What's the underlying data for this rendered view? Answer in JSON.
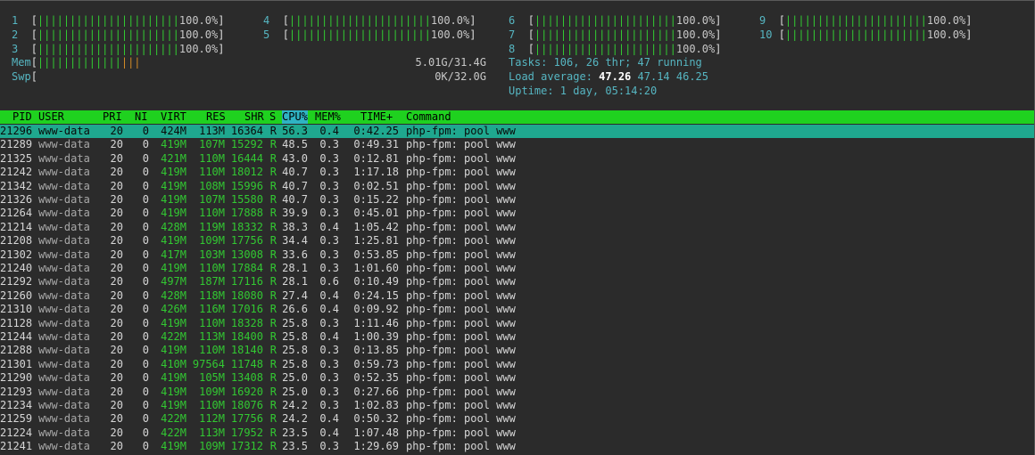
{
  "cpus": [
    {
      "id": "1",
      "pct": "100.0%"
    },
    {
      "id": "2",
      "pct": "100.0%"
    },
    {
      "id": "3",
      "pct": "100.0%"
    },
    {
      "id": "4",
      "pct": "100.0%"
    },
    {
      "id": "5",
      "pct": "100.0%"
    },
    {
      "id": "6",
      "pct": "100.0%"
    },
    {
      "id": "7",
      "pct": "100.0%"
    },
    {
      "id": "8",
      "pct": "100.0%"
    },
    {
      "id": "9",
      "pct": "100.0%"
    },
    {
      "id": "10",
      "pct": "100.0%"
    }
  ],
  "cpu_bar": "||||||||||||||||||||||",
  "mem": {
    "label": "Mem",
    "used_bar": "|||||||||||||",
    "buf_bar": "|||",
    "value": "5.01G/31.4G"
  },
  "swp": {
    "label": "Swp",
    "value": "0K/32.0G"
  },
  "tasks": {
    "label": "Tasks: ",
    "count": "106",
    "sep": ", ",
    "thr": "26",
    "thr_label": " thr; ",
    "running": "47",
    "running_label": " running"
  },
  "load": {
    "label": "Load average: ",
    "l1": "47.26",
    "l5": "47.14",
    "l15": "46.25"
  },
  "uptime": {
    "label": "Uptime: ",
    "value": "1 day, 05:14:20"
  },
  "columns": {
    "pid": "PID",
    "user": "USER",
    "pri": "PRI",
    "ni": "NI",
    "virt": "VIRT",
    "res": "RES",
    "shr": "SHR",
    "s": "S",
    "cpu": "CPU%",
    "mem": "MEM%",
    "time": "TIME+",
    "cmd": "Command"
  },
  "colors": {
    "header_bg": "#1fd11f",
    "selected_bg": "#1fa88f",
    "sort_col_bg": "#2fb3c3",
    "bar": "#32c832",
    "mem_buf": "#d08a26",
    "cyan": "#56b6c2",
    "background": "#2b2b2b"
  },
  "processes": [
    {
      "pid": "21296",
      "user": "www-data",
      "pri": "20",
      "ni": "0",
      "virt": "424M",
      "res": "113M",
      "shr": "16364",
      "s": "R",
      "cpu": "56.3",
      "mem": "0.4",
      "time": "0:42.25",
      "cmd": "php-fpm: pool www"
    },
    {
      "pid": "21289",
      "user": "www-data",
      "pri": "20",
      "ni": "0",
      "virt": "419M",
      "res": "107M",
      "shr": "15292",
      "s": "R",
      "cpu": "48.5",
      "mem": "0.3",
      "time": "0:49.31",
      "cmd": "php-fpm: pool www"
    },
    {
      "pid": "21325",
      "user": "www-data",
      "pri": "20",
      "ni": "0",
      "virt": "421M",
      "res": "110M",
      "shr": "16444",
      "s": "R",
      "cpu": "43.0",
      "mem": "0.3",
      "time": "0:12.81",
      "cmd": "php-fpm: pool www"
    },
    {
      "pid": "21242",
      "user": "www-data",
      "pri": "20",
      "ni": "0",
      "virt": "419M",
      "res": "110M",
      "shr": "18012",
      "s": "R",
      "cpu": "40.7",
      "mem": "0.3",
      "time": "1:17.18",
      "cmd": "php-fpm: pool www"
    },
    {
      "pid": "21342",
      "user": "www-data",
      "pri": "20",
      "ni": "0",
      "virt": "419M",
      "res": "108M",
      "shr": "15996",
      "s": "R",
      "cpu": "40.7",
      "mem": "0.3",
      "time": "0:02.51",
      "cmd": "php-fpm: pool www"
    },
    {
      "pid": "21326",
      "user": "www-data",
      "pri": "20",
      "ni": "0",
      "virt": "419M",
      "res": "107M",
      "shr": "15580",
      "s": "R",
      "cpu": "40.7",
      "mem": "0.3",
      "time": "0:15.22",
      "cmd": "php-fpm: pool www"
    },
    {
      "pid": "21264",
      "user": "www-data",
      "pri": "20",
      "ni": "0",
      "virt": "419M",
      "res": "110M",
      "shr": "17888",
      "s": "R",
      "cpu": "39.9",
      "mem": "0.3",
      "time": "0:45.01",
      "cmd": "php-fpm: pool www"
    },
    {
      "pid": "21214",
      "user": "www-data",
      "pri": "20",
      "ni": "0",
      "virt": "428M",
      "res": "119M",
      "shr": "18332",
      "s": "R",
      "cpu": "38.3",
      "mem": "0.4",
      "time": "1:05.42",
      "cmd": "php-fpm: pool www"
    },
    {
      "pid": "21208",
      "user": "www-data",
      "pri": "20",
      "ni": "0",
      "virt": "419M",
      "res": "109M",
      "shr": "17756",
      "s": "R",
      "cpu": "34.4",
      "mem": "0.3",
      "time": "1:25.81",
      "cmd": "php-fpm: pool www"
    },
    {
      "pid": "21302",
      "user": "www-data",
      "pri": "20",
      "ni": "0",
      "virt": "417M",
      "res": "103M",
      "shr": "13008",
      "s": "R",
      "cpu": "33.6",
      "mem": "0.3",
      "time": "0:53.85",
      "cmd": "php-fpm: pool www"
    },
    {
      "pid": "21240",
      "user": "www-data",
      "pri": "20",
      "ni": "0",
      "virt": "419M",
      "res": "110M",
      "shr": "17884",
      "s": "R",
      "cpu": "28.1",
      "mem": "0.3",
      "time": "1:01.60",
      "cmd": "php-fpm: pool www"
    },
    {
      "pid": "21292",
      "user": "www-data",
      "pri": "20",
      "ni": "0",
      "virt": "497M",
      "res": "187M",
      "shr": "17116",
      "s": "R",
      "cpu": "28.1",
      "mem": "0.6",
      "time": "0:10.49",
      "cmd": "php-fpm: pool www"
    },
    {
      "pid": "21260",
      "user": "www-data",
      "pri": "20",
      "ni": "0",
      "virt": "428M",
      "res": "118M",
      "shr": "18080",
      "s": "R",
      "cpu": "27.4",
      "mem": "0.4",
      "time": "0:24.15",
      "cmd": "php-fpm: pool www"
    },
    {
      "pid": "21310",
      "user": "www-data",
      "pri": "20",
      "ni": "0",
      "virt": "426M",
      "res": "116M",
      "shr": "17016",
      "s": "R",
      "cpu": "26.6",
      "mem": "0.4",
      "time": "0:09.92",
      "cmd": "php-fpm: pool www"
    },
    {
      "pid": "21128",
      "user": "www-data",
      "pri": "20",
      "ni": "0",
      "virt": "419M",
      "res": "110M",
      "shr": "18328",
      "s": "R",
      "cpu": "25.8",
      "mem": "0.3",
      "time": "1:11.46",
      "cmd": "php-fpm: pool www"
    },
    {
      "pid": "21244",
      "user": "www-data",
      "pri": "20",
      "ni": "0",
      "virt": "422M",
      "res": "113M",
      "shr": "18400",
      "s": "R",
      "cpu": "25.8",
      "mem": "0.4",
      "time": "1:00.39",
      "cmd": "php-fpm: pool www"
    },
    {
      "pid": "21288",
      "user": "www-data",
      "pri": "20",
      "ni": "0",
      "virt": "419M",
      "res": "110M",
      "shr": "18140",
      "s": "R",
      "cpu": "25.8",
      "mem": "0.3",
      "time": "0:13.85",
      "cmd": "php-fpm: pool www"
    },
    {
      "pid": "21301",
      "user": "www-data",
      "pri": "20",
      "ni": "0",
      "virt": "410M",
      "res": "97564",
      "shr": "11748",
      "s": "R",
      "cpu": "25.8",
      "mem": "0.3",
      "time": "0:59.73",
      "cmd": "php-fpm: pool www"
    },
    {
      "pid": "21290",
      "user": "www-data",
      "pri": "20",
      "ni": "0",
      "virt": "419M",
      "res": "105M",
      "shr": "13408",
      "s": "R",
      "cpu": "25.0",
      "mem": "0.3",
      "time": "0:52.35",
      "cmd": "php-fpm: pool www"
    },
    {
      "pid": "21293",
      "user": "www-data",
      "pri": "20",
      "ni": "0",
      "virt": "419M",
      "res": "109M",
      "shr": "16920",
      "s": "R",
      "cpu": "25.0",
      "mem": "0.3",
      "time": "0:27.66",
      "cmd": "php-fpm: pool www"
    },
    {
      "pid": "21234",
      "user": "www-data",
      "pri": "20",
      "ni": "0",
      "virt": "419M",
      "res": "110M",
      "shr": "18076",
      "s": "R",
      "cpu": "24.2",
      "mem": "0.3",
      "time": "1:02.83",
      "cmd": "php-fpm: pool www"
    },
    {
      "pid": "21259",
      "user": "www-data",
      "pri": "20",
      "ni": "0",
      "virt": "422M",
      "res": "112M",
      "shr": "17756",
      "s": "R",
      "cpu": "24.2",
      "mem": "0.4",
      "time": "0:50.32",
      "cmd": "php-fpm: pool www"
    },
    {
      "pid": "21224",
      "user": "www-data",
      "pri": "20",
      "ni": "0",
      "virt": "422M",
      "res": "113M",
      "shr": "17952",
      "s": "R",
      "cpu": "23.5",
      "mem": "0.4",
      "time": "1:07.48",
      "cmd": "php-fpm: pool www"
    },
    {
      "pid": "21241",
      "user": "www-data",
      "pri": "20",
      "ni": "0",
      "virt": "419M",
      "res": "109M",
      "shr": "17312",
      "s": "R",
      "cpu": "23.5",
      "mem": "0.3",
      "time": "1:29.69",
      "cmd": "php-fpm: pool www"
    }
  ]
}
